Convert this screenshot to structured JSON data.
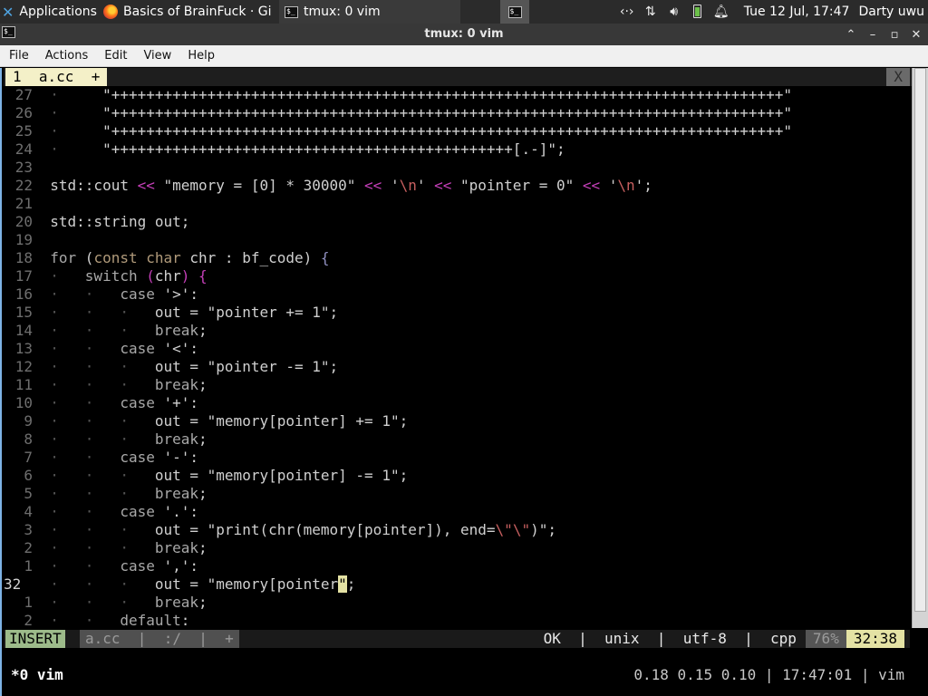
{
  "panel": {
    "apps_label": "Applications",
    "firefox_label": "Basics of BrainFuck · Gi",
    "tmux_label": "tmux: 0 vim",
    "clock": "Tue 12 Jul, 17:47",
    "user": "Darty uwu"
  },
  "window": {
    "title": "tmux: 0 vim"
  },
  "menu": [
    "File",
    "Actions",
    "Edit",
    "View",
    "Help"
  ],
  "vim": {
    "tab_label": "1  a.cc  +",
    "tab_close": "X",
    "lines": [
      {
        "num": "27",
        "ind": "  ·   ",
        "code": [
          [
            "  \"+++++++++++++++++++++++++++++++++++++++++++++++++++++++++++++++++++++++++++++\"",
            "str"
          ]
        ]
      },
      {
        "num": "26",
        "ind": "  ·   ",
        "code": [
          [
            "  \"+++++++++++++++++++++++++++++++++++++++++++++++++++++++++++++++++++++++++++++\"",
            "str"
          ]
        ]
      },
      {
        "num": "25",
        "ind": "  ·   ",
        "code": [
          [
            "  \"+++++++++++++++++++++++++++++++++++++++++++++++++++++++++++++++++++++++++++++\"",
            "str"
          ]
        ]
      },
      {
        "num": "24",
        "ind": "  ·   ",
        "code": [
          [
            "  \"++++++++++++++++++++++++++++++++++++++++++++++[.-]\";",
            "str"
          ]
        ]
      },
      {
        "num": "23",
        "ind": "",
        "code": []
      },
      {
        "num": "22",
        "ind": "  ",
        "code": [
          [
            "std::cout ",
            "norm"
          ],
          [
            "<<",
            "op"
          ],
          [
            " \"memory = [0] * 30000\" ",
            "str"
          ],
          [
            "<<",
            "op"
          ],
          [
            " '",
            "norm"
          ],
          [
            "\\n",
            "esc"
          ],
          [
            "' ",
            "norm"
          ],
          [
            "<<",
            "op"
          ],
          [
            " \"pointer = 0\" ",
            "str"
          ],
          [
            "<<",
            "op"
          ],
          [
            " '",
            "norm"
          ],
          [
            "\\n",
            "esc"
          ],
          [
            "';",
            "norm"
          ]
        ]
      },
      {
        "num": "21",
        "ind": "",
        "code": []
      },
      {
        "num": "20",
        "ind": "  ",
        "code": [
          [
            "std::string out;",
            "norm"
          ]
        ]
      },
      {
        "num": "19",
        "ind": "",
        "code": []
      },
      {
        "num": "18",
        "ind": "  ",
        "code": [
          [
            "for",
            "kw"
          ],
          [
            " (",
            "norm"
          ],
          [
            "const char",
            "type"
          ],
          [
            " chr : bf_code) ",
            "norm"
          ],
          [
            "{",
            "brace"
          ]
        ]
      },
      {
        "num": "17",
        "ind": "  ·   ",
        "code": [
          [
            "switch",
            "kw"
          ],
          [
            " (",
            "paren"
          ],
          [
            "chr",
            "norm"
          ],
          [
            ")",
            "paren"
          ],
          [
            " ",
            "norm"
          ],
          [
            "{",
            "paren"
          ]
        ]
      },
      {
        "num": "16",
        "ind": "  ·   ·   ",
        "code": [
          [
            "case",
            "kw"
          ],
          [
            " '>':",
            "norm"
          ]
        ]
      },
      {
        "num": "15",
        "ind": "  ·   ·   ·   ",
        "code": [
          [
            "out = \"pointer += 1\";",
            "norm"
          ]
        ]
      },
      {
        "num": "14",
        "ind": "  ·   ·   ·   ",
        "code": [
          [
            "break",
            "kw"
          ],
          [
            ";",
            "norm"
          ]
        ]
      },
      {
        "num": "13",
        "ind": "  ·   ·   ",
        "code": [
          [
            "case",
            "kw"
          ],
          [
            " '<':",
            "norm"
          ]
        ]
      },
      {
        "num": "12",
        "ind": "  ·   ·   ·   ",
        "code": [
          [
            "out = \"pointer -= 1\";",
            "norm"
          ]
        ]
      },
      {
        "num": "11",
        "ind": "  ·   ·   ·   ",
        "code": [
          [
            "break",
            "kw"
          ],
          [
            ";",
            "norm"
          ]
        ]
      },
      {
        "num": "10",
        "ind": "  ·   ·   ",
        "code": [
          [
            "case",
            "kw"
          ],
          [
            " '+':",
            "norm"
          ]
        ]
      },
      {
        "num": "9",
        "ind": "  ·   ·   ·   ",
        "code": [
          [
            "out = \"memory[pointer] += 1\";",
            "norm"
          ]
        ]
      },
      {
        "num": "8",
        "ind": "  ·   ·   ·   ",
        "code": [
          [
            "break",
            "kw"
          ],
          [
            ";",
            "norm"
          ]
        ]
      },
      {
        "num": "7",
        "ind": "  ·   ·   ",
        "code": [
          [
            "case",
            "kw"
          ],
          [
            " '-':",
            "norm"
          ]
        ]
      },
      {
        "num": "6",
        "ind": "  ·   ·   ·   ",
        "code": [
          [
            "out = \"memory[pointer] -= 1\";",
            "norm"
          ]
        ]
      },
      {
        "num": "5",
        "ind": "  ·   ·   ·   ",
        "code": [
          [
            "break",
            "kw"
          ],
          [
            ";",
            "norm"
          ]
        ]
      },
      {
        "num": "4",
        "ind": "  ·   ·   ",
        "code": [
          [
            "case",
            "kw"
          ],
          [
            " '.':",
            "norm"
          ]
        ]
      },
      {
        "num": "3",
        "ind": "  ·   ·   ·   ",
        "code": [
          [
            "out = \"print(chr(memory[pointer]), end=",
            "norm"
          ],
          [
            "\\\"\\\"",
            "esc"
          ],
          [
            ")\";",
            "norm"
          ]
        ]
      },
      {
        "num": "2",
        "ind": "  ·   ·   ·   ",
        "code": [
          [
            "break",
            "kw"
          ],
          [
            ";",
            "norm"
          ]
        ]
      },
      {
        "num": "1",
        "ind": "  ·   ·   ",
        "code": [
          [
            "case",
            "kw"
          ],
          [
            " ',':",
            "norm"
          ]
        ]
      },
      {
        "num": "32",
        "ind": "  ·   ·   ·   ",
        "current": true,
        "code": [
          [
            "out = \"memory[pointer",
            "norm"
          ],
          [
            "\"",
            "cursor"
          ],
          [
            ";",
            "norm"
          ]
        ]
      },
      {
        "num": "1",
        "ind": "  ·   ·   ·   ",
        "code": [
          [
            "break",
            "kw"
          ],
          [
            ";",
            "norm"
          ]
        ]
      },
      {
        "num": "2",
        "ind": "  ·   ·   ",
        "code": [
          [
            "default",
            "kw"
          ],
          [
            ":",
            "norm"
          ]
        ]
      }
    ],
    "status": {
      "mode": "INSERT",
      "file": "a.cc  |  :/  |  +",
      "info": "OK  |  unix  |  utf-8  |  cpp",
      "percent": "76%",
      "position": "32:38"
    }
  },
  "tmux": {
    "window": "*0 vim",
    "right": "0.18 0.15 0.10 | 17:47:01 | vim"
  }
}
